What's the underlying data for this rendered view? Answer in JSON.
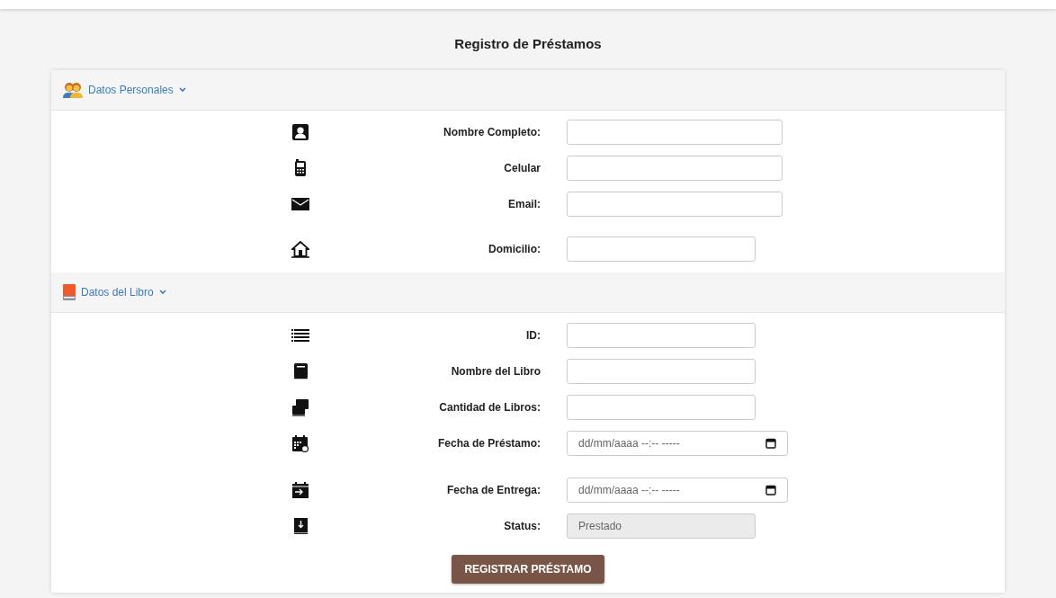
{
  "title": "Registro de Préstamos",
  "sections": [
    {
      "title": "Datos Personales",
      "expanded": true,
      "fields": [
        {
          "label": "Nombre Completo:",
          "kind": "text"
        },
        {
          "label": "Celular",
          "kind": "text"
        },
        {
          "label": "Email:",
          "kind": "text"
        },
        {
          "label": "Domicilio:",
          "kind": "text"
        }
      ]
    },
    {
      "title": "Datos del Libro",
      "expanded": true,
      "fields": [
        {
          "label": "ID:",
          "kind": "text"
        },
        {
          "label": "Nombre del Libro",
          "kind": "text"
        },
        {
          "label": "Cantidad de Libros:",
          "kind": "text"
        },
        {
          "label": "Fecha de Préstamo:",
          "kind": "datetime",
          "placeholder": "dd/mm/aaaa --:-- -----"
        },
        {
          "label": "Fecha de Entrega:",
          "kind": "datetime",
          "placeholder": "dd/mm/aaaa --:-- -----"
        },
        {
          "label": "Status:",
          "kind": "readonly",
          "value": "Prestado"
        }
      ]
    }
  ],
  "submit": "REGISTRAR PRÉSTAMO"
}
